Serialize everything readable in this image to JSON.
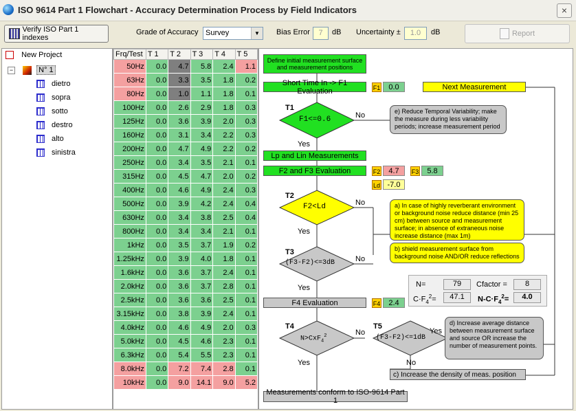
{
  "window": {
    "title": "ISO 9614 Part 1 Flowchart - Accuracy Determination Process by Field Indicators",
    "close": "×"
  },
  "toolbar": {
    "verify_label": "Verify ISO Part 1 indexes",
    "grade_label": "Grade of Accuracy",
    "grade_value": "Survey",
    "bias_label": "Bias Error",
    "bias_value": "7",
    "bias_unit": "dB",
    "uncertainty_label": "Uncertainty ±",
    "uncertainty_value": "1.0",
    "uncertainty_unit": "dB",
    "report_label": "Report"
  },
  "tree": {
    "root": "New Project",
    "node": "N° 1",
    "children": [
      "dietro",
      "sopra",
      "sotto",
      "destro",
      "alto",
      "sinistra"
    ]
  },
  "table": {
    "headers": [
      "Frq/Test",
      "T 1",
      "T 2",
      "T 3",
      "T 4",
      "T 5"
    ],
    "rows": [
      {
        "f": "50Hz",
        "v": [
          "0.0",
          "4.7",
          "5.8",
          "2.4",
          "1.1"
        ]
      },
      {
        "f": "63Hz",
        "v": [
          "0.0",
          "3.3",
          "3.5",
          "1.8",
          "0.2"
        ]
      },
      {
        "f": "80Hz",
        "v": [
          "0.0",
          "1.0",
          "1.1",
          "1.8",
          "0.1"
        ]
      },
      {
        "f": "100Hz",
        "v": [
          "0.0",
          "2.6",
          "2.9",
          "1.8",
          "0.3"
        ]
      },
      {
        "f": "125Hz",
        "v": [
          "0.0",
          "3.6",
          "3.9",
          "2.0",
          "0.3"
        ]
      },
      {
        "f": "160Hz",
        "v": [
          "0.0",
          "3.1",
          "3.4",
          "2.2",
          "0.3"
        ]
      },
      {
        "f": "200Hz",
        "v": [
          "0.0",
          "4.7",
          "4.9",
          "2.2",
          "0.2"
        ]
      },
      {
        "f": "250Hz",
        "v": [
          "0.0",
          "3.4",
          "3.5",
          "2.1",
          "0.1"
        ]
      },
      {
        "f": "315Hz",
        "v": [
          "0.0",
          "4.5",
          "4.7",
          "2.0",
          "0.2"
        ]
      },
      {
        "f": "400Hz",
        "v": [
          "0.0",
          "4.6",
          "4.9",
          "2.4",
          "0.3"
        ]
      },
      {
        "f": "500Hz",
        "v": [
          "0.0",
          "3.9",
          "4.2",
          "2.4",
          "0.4"
        ]
      },
      {
        "f": "630Hz",
        "v": [
          "0.0",
          "3.4",
          "3.8",
          "2.5",
          "0.4"
        ]
      },
      {
        "f": "800Hz",
        "v": [
          "0.0",
          "3.4",
          "3.4",
          "2.1",
          "0.1"
        ]
      },
      {
        "f": "1kHz",
        "v": [
          "0.0",
          "3.5",
          "3.7",
          "1.9",
          "0.2"
        ]
      },
      {
        "f": "1.25kHz",
        "v": [
          "0.0",
          "3.9",
          "4.0",
          "1.8",
          "0.1"
        ]
      },
      {
        "f": "1.6kHz",
        "v": [
          "0.0",
          "3.6",
          "3.7",
          "2.4",
          "0.1"
        ]
      },
      {
        "f": "2.0kHz",
        "v": [
          "0.0",
          "3.6",
          "3.7",
          "2.8",
          "0.1"
        ]
      },
      {
        "f": "2.5kHz",
        "v": [
          "0.0",
          "3.6",
          "3.6",
          "2.5",
          "0.1"
        ]
      },
      {
        "f": "3.15kHz",
        "v": [
          "0.0",
          "3.8",
          "3.9",
          "2.4",
          "0.1"
        ]
      },
      {
        "f": "4.0kHz",
        "v": [
          "0.0",
          "4.6",
          "4.9",
          "2.0",
          "0.3"
        ]
      },
      {
        "f": "5.0kHz",
        "v": [
          "0.0",
          "4.5",
          "4.6",
          "2.3",
          "0.1"
        ]
      },
      {
        "f": "6.3kHz",
        "v": [
          "0.0",
          "5.4",
          "5.5",
          "2.3",
          "0.1"
        ]
      },
      {
        "f": "8.0kHz",
        "v": [
          "0.0",
          "7.2",
          "7.4",
          "2.8",
          "0.1"
        ]
      },
      {
        "f": "10kHz",
        "v": [
          "0.0",
          "9.0",
          "14.1",
          "9.0",
          "5.2"
        ]
      }
    ]
  },
  "flow": {
    "define": "Define initial measurement surface and measurement positions",
    "short_time": "Short Time In -> F1 Evaluation",
    "f1_tag": "F1",
    "f1_value": "0.0",
    "next_measurement": "Next Measurement",
    "t1": "T1",
    "t1_text": "F1<=0.6",
    "no": "No",
    "yes": "Yes",
    "note_e": "e) Reduce Temporal Variability; make the measure during less variability periods; increase measurement period",
    "lp_lin": "Lp and Lin Measurements",
    "f2f3": "F2 and F3 Evaluation",
    "f2_tag": "F2",
    "f2_value": "4.7",
    "f3_tag": "F3",
    "f3_value": "5.8",
    "ld_tag": "Ld",
    "ld_value": "-7.0",
    "t2": "T2",
    "t2_text": "F2<Ld",
    "note_a": "a) In case of highly reverberant environment or background noise reduce distance (min 25 cm) between source and measurement surface; in absence of extraneous noise increase distance (max 1m)",
    "note_b": "b) shield measurement surface from background noise AND/OR reduce reflections",
    "t3": "T3",
    "t3_text": "(F3-F2)<=3dB",
    "n_label": "N=",
    "n_value": "79",
    "cfactor_label": "Cfactor =",
    "cfactor_value": "8",
    "cf4_label": "C·F",
    "cf4_value": "47.1",
    "ncf4_label": "N-C·F",
    "ncf4_value": "4.0",
    "f4_eval": "F4 Evaluation",
    "f4_tag": "F4",
    "f4_value": "2.4",
    "t4": "T4",
    "t4_text": "N>CxF",
    "t5": "T5",
    "t5_text": "(F3-F2)<=1dB",
    "note_d": "d) Increase average distance between measurement surface and source OR increase the number of measurement points.",
    "note_c": "c) Increase the density of meas. position",
    "conform": "Measurements conform to ISO-9614 Part 1"
  }
}
